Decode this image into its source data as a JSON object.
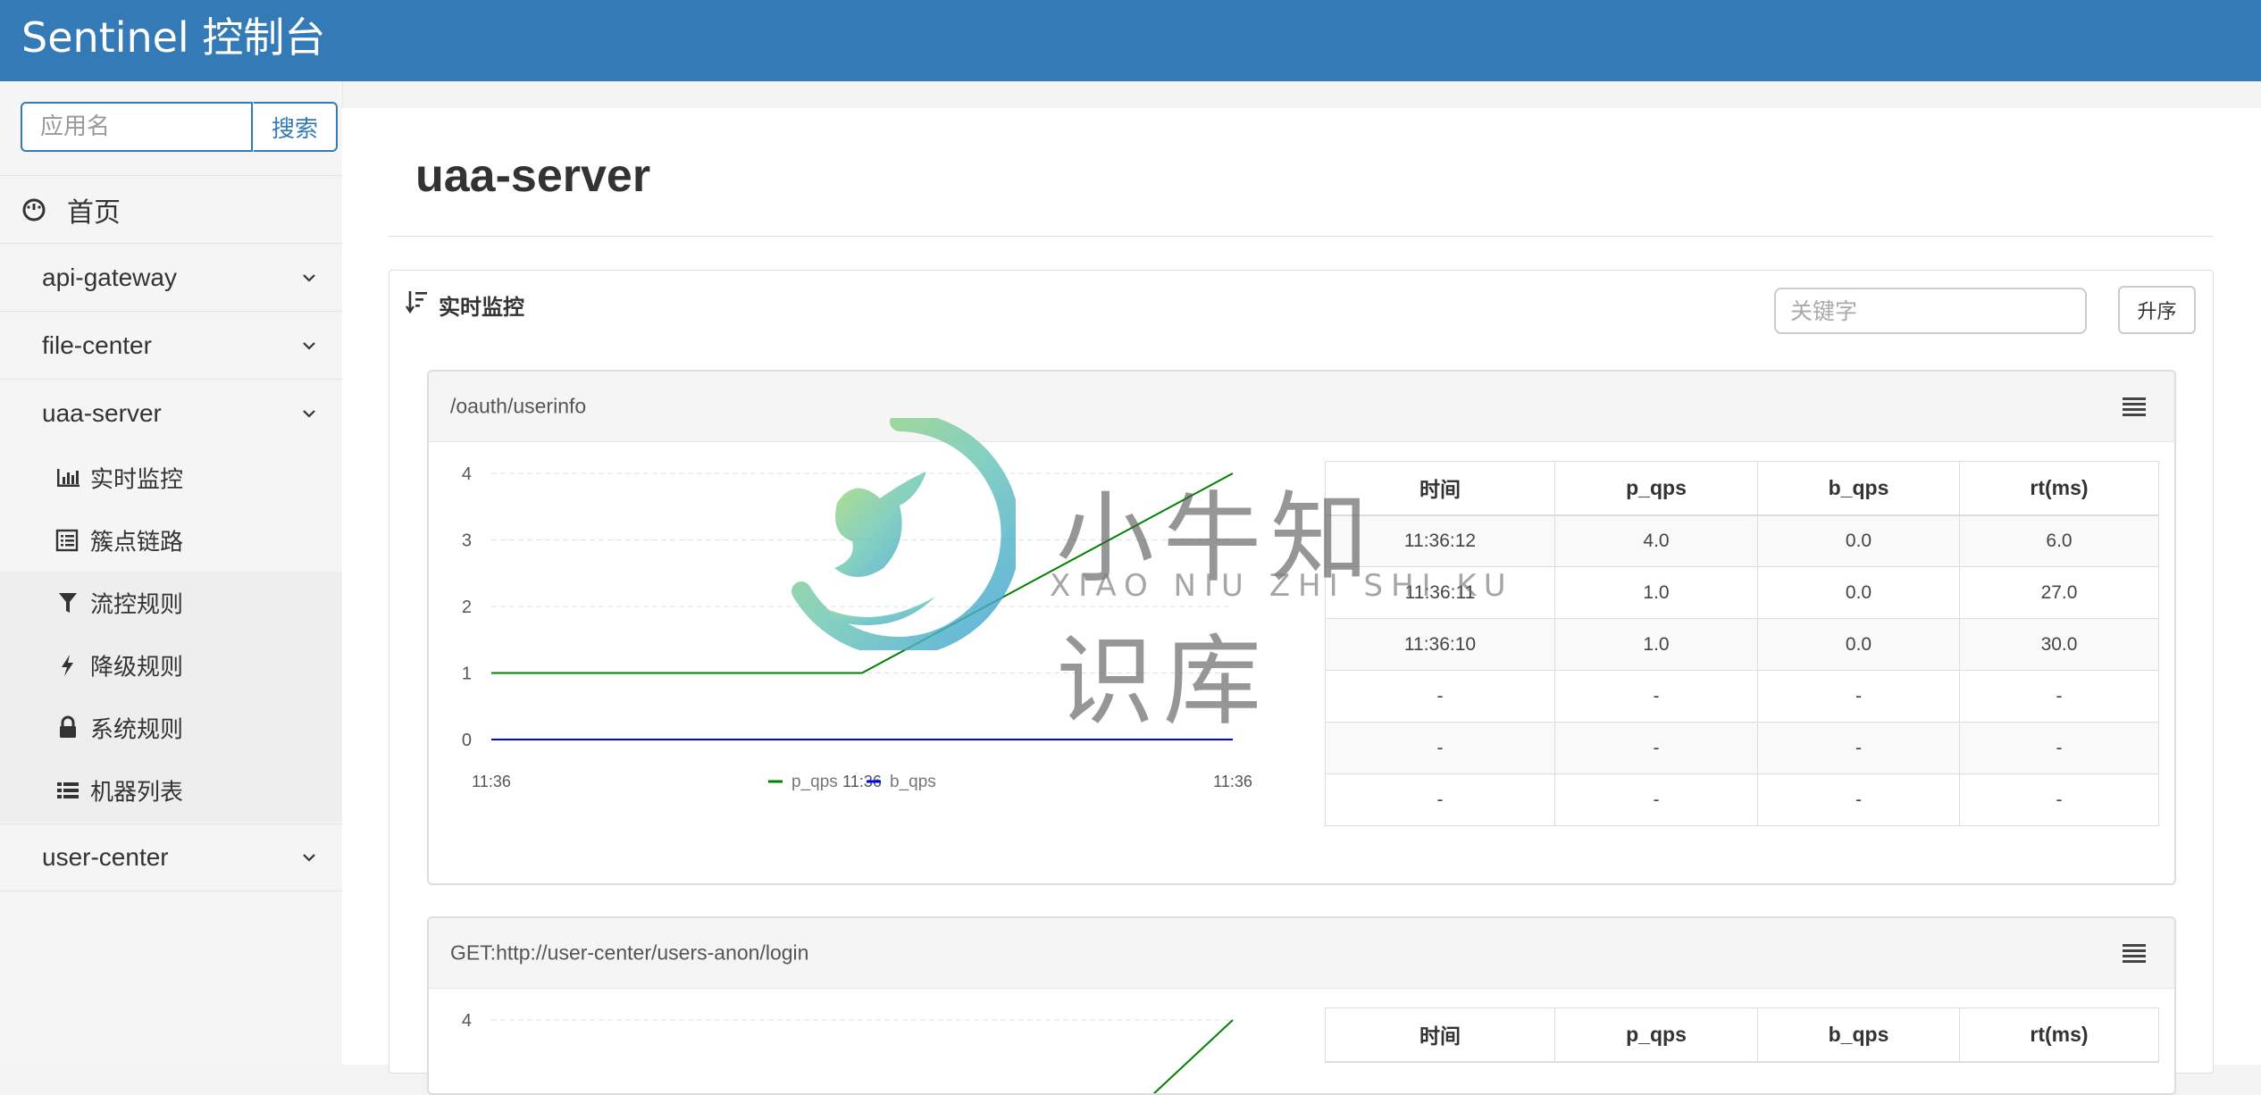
{
  "header": {
    "brand": "Sentinel 控制台"
  },
  "sidebar": {
    "search_placeholder": "应用名",
    "search_button": "搜索",
    "home_label": "首页",
    "apps": [
      {
        "label": "api-gateway"
      },
      {
        "label": "file-center"
      },
      {
        "label": "uaa-server"
      },
      {
        "label": "user-center"
      }
    ],
    "submenu": [
      {
        "label": "实时监控",
        "icon": "bar-chart-icon"
      },
      {
        "label": "簇点链路",
        "icon": "list-icon"
      },
      {
        "label": "流控规则",
        "icon": "filter-icon"
      },
      {
        "label": "降级规则",
        "icon": "flash-icon"
      },
      {
        "label": "系统规则",
        "icon": "lock-icon"
      },
      {
        "label": "机器列表",
        "icon": "th-list-icon"
      }
    ]
  },
  "main": {
    "title": "uaa-server",
    "panel": {
      "title": "实时监控",
      "keyword_placeholder": "关键字",
      "sort_button": "升序"
    },
    "resources": [
      {
        "name": "/oauth/userinfo",
        "table": {
          "headers": [
            "时间",
            "p_qps",
            "b_qps",
            "rt(ms)"
          ],
          "rows": [
            [
              "11:36:12",
              "4.0",
              "0.0",
              "6.0"
            ],
            [
              "11:36:11",
              "1.0",
              "0.0",
              "27.0"
            ],
            [
              "11:36:10",
              "1.0",
              "0.0",
              "30.0"
            ],
            [
              "-",
              "-",
              "-",
              "-"
            ],
            [
              "-",
              "-",
              "-",
              "-"
            ],
            [
              "-",
              "-",
              "-",
              "-"
            ]
          ]
        }
      },
      {
        "name": "GET:http://user-center/users-anon/login",
        "table": {
          "headers": [
            "时间",
            "p_qps",
            "b_qps",
            "rt(ms)"
          ],
          "rows": []
        }
      }
    ]
  },
  "chart_data": [
    {
      "type": "line",
      "x": [
        "11:36",
        "11:36",
        "11:36"
      ],
      "y_ticks": [
        0,
        1,
        2,
        3,
        4
      ],
      "ylim": [
        0,
        4
      ],
      "series": [
        {
          "name": "p_qps",
          "color": "#008000",
          "values": [
            1,
            1,
            4
          ]
        },
        {
          "name": "b_qps",
          "color": "#0000ff",
          "values": [
            0,
            0,
            0
          ]
        }
      ],
      "legend": "bottom-center",
      "grid": true
    },
    {
      "type": "line",
      "x": [],
      "y_ticks": [
        4
      ],
      "ylim": [
        0,
        4
      ],
      "series": [
        {
          "name": "p_qps",
          "color": "#008000",
          "values": []
        }
      ],
      "grid": true
    }
  ],
  "watermark": {
    "text": "小牛知识库",
    "subtext": "XIAO NIU ZHI SHI KU"
  }
}
